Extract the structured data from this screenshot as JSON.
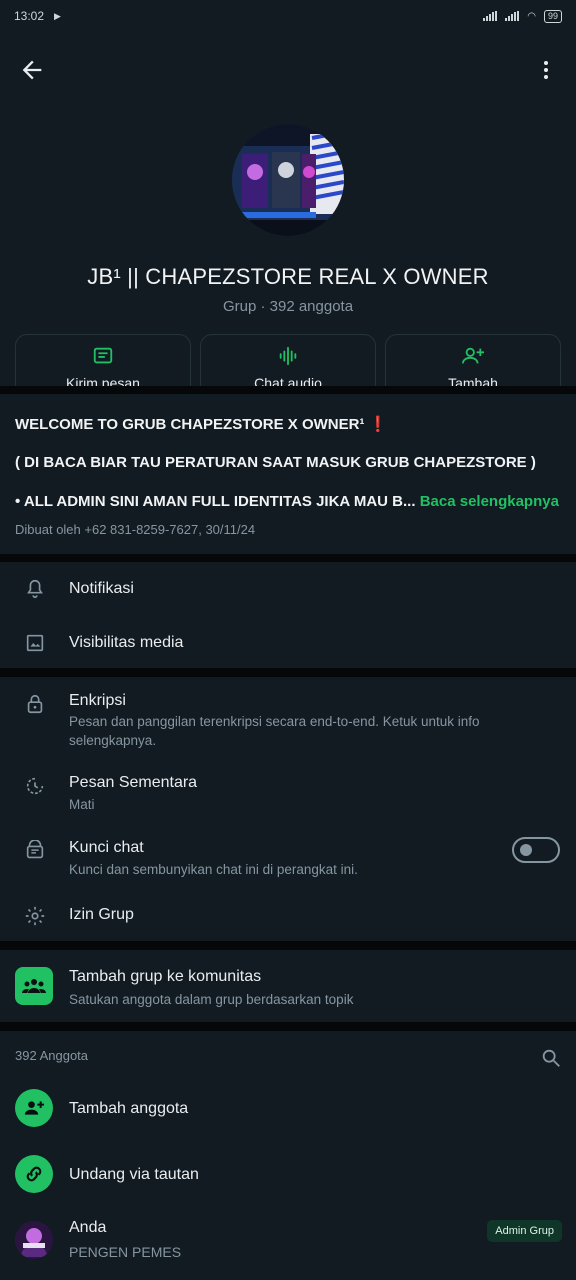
{
  "status_bar": {
    "time": "13:02",
    "battery": "99"
  },
  "header": {
    "group_name": "JB¹ || CHAPEZSTORE REAL  X OWNER",
    "subtitle": "Grup · 392 anggota"
  },
  "actions": [
    {
      "label": "Kirim pesan",
      "icon": "message-icon"
    },
    {
      "label": "Chat audio",
      "icon": "audio-wave-icon"
    },
    {
      "label": "Tambah",
      "icon": "add-person-icon"
    }
  ],
  "description": {
    "title": "WELCOME TO GRUB CHAPEZSTORE X OWNER¹",
    "title_emoji": "❗",
    "line2": "( DI BACA BIAR TAU PERATURAN SAAT MASUK GRUB CHAPEZSTORE )",
    "line3": "• ALL ADMIN SINI AMAN FULL IDENTITAS JIKA MAU B...",
    "read_more": "Baca selengkapnya",
    "created_by": "Dibuat oleh +62 831-8259-7627, 30/11/24"
  },
  "settings_a": [
    {
      "title": "Notifikasi",
      "icon": "bell-icon"
    },
    {
      "title": "Visibilitas media",
      "icon": "image-icon"
    }
  ],
  "settings_b": {
    "encryption": {
      "title": "Enkripsi",
      "subtitle": "Pesan dan panggilan terenkripsi secara end-to-end. Ketuk untuk info selengkapnya."
    },
    "disappearing": {
      "title": "Pesan Sementara",
      "subtitle": "Mati"
    },
    "chat_lock": {
      "title": "Kunci chat",
      "subtitle": "Kunci dan sembunyikan chat ini di perangkat ini.",
      "enabled": false
    },
    "permissions": {
      "title": "Izin Grup"
    }
  },
  "community": {
    "title": "Tambah grup ke komunitas",
    "subtitle": "Satukan anggota dalam grup berdasarkan topik"
  },
  "members": {
    "count_label": "392 Anggota",
    "add_member": "Tambah anggota",
    "invite_link": "Undang via tautan",
    "list": [
      {
        "name": "Anda",
        "status": "PENGEN PEMES",
        "badge": "Admin Grup"
      }
    ]
  },
  "colors": {
    "accent": "#21c063",
    "background": "#121b22",
    "separator": "#050708",
    "text_secondary": "#8696a0"
  }
}
